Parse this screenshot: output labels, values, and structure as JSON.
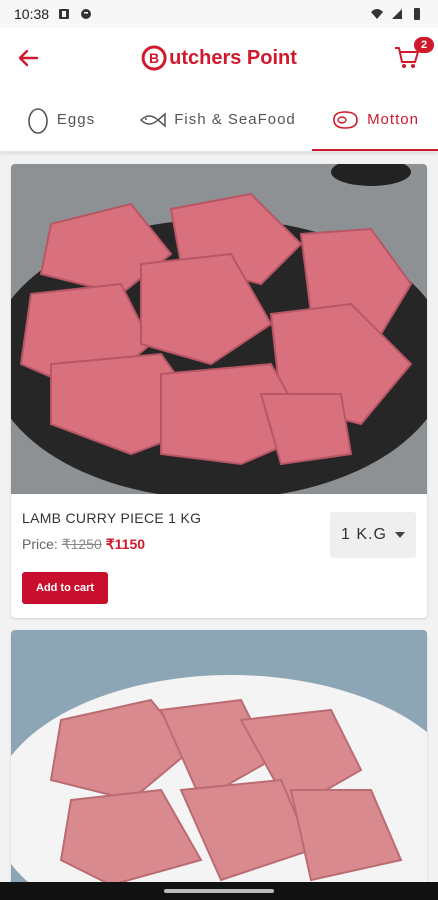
{
  "status": {
    "time": "10:38"
  },
  "app": {
    "brand_letter": "B",
    "brand_rest": "utchers Point",
    "cart_count": "2"
  },
  "tabs": [
    {
      "label": "Eggs",
      "icon": "egg-icon"
    },
    {
      "label": "Fish & SeaFood",
      "icon": "fish-icon"
    },
    {
      "label": "Motton",
      "icon": "meat-icon",
      "active": true
    }
  ],
  "products": [
    {
      "name": "LAMB CURRY PIECE 1 KG",
      "price_label": "Price:",
      "old_price": "₹1250",
      "new_price": "₹1150",
      "qty": "1 K.G",
      "add_label": "Add to cart"
    }
  ],
  "colors": {
    "accent": "#d0192c"
  }
}
